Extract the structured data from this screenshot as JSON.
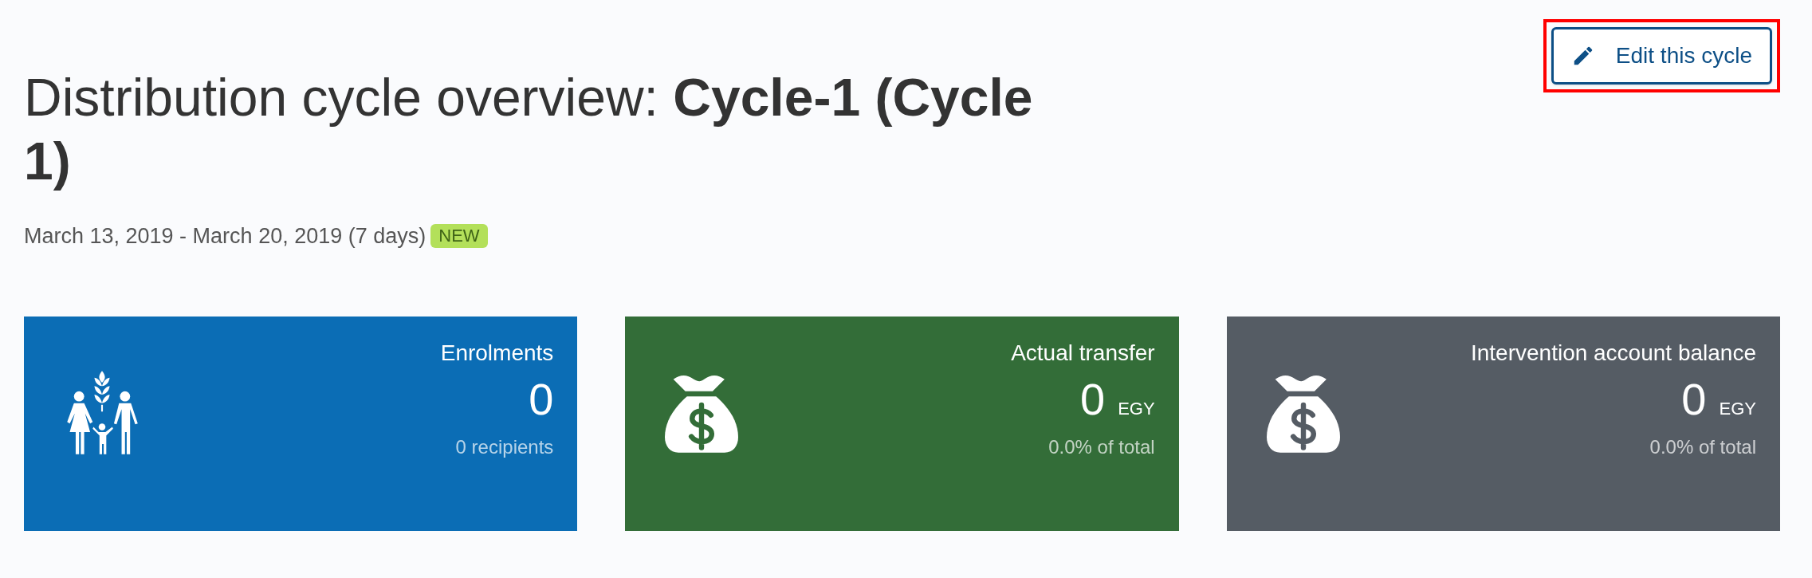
{
  "edit_button": {
    "label": "Edit this cycle",
    "highlighted": true
  },
  "title": "Distribution cycle overview: **Cycle-1 (Cycle 1)**",
  "date_range": "March 13, 2019 - March 20, 2019 (7 days)",
  "status_badge": "NEW",
  "cards": [
    {
      "kind": "count",
      "color": "#0b6db5",
      "label": "Enrolments",
      "value": "0",
      "subtitle": "0 recipients"
    },
    {
      "kind": "amount",
      "color": "#336d38",
      "label": "Actual transfer",
      "value": "0",
      "unit": "EGY",
      "subtitle": "0.0% of total"
    },
    {
      "kind": "amount",
      "color": "#555c64",
      "label": "Intervention account balance",
      "value": "0",
      "unit": "EGY",
      "subtitle": "0.0% of total"
    }
  ]
}
